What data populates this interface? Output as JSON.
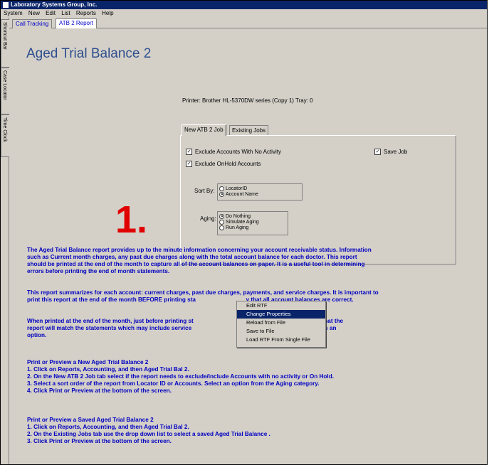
{
  "window": {
    "title": "Laboratory Systems Group, Inc."
  },
  "menubar": [
    "System",
    "New",
    "Edit",
    "List",
    "Reports",
    "Help"
  ],
  "left_tabs": [
    "Shortcut Bar",
    "Case Locator",
    "Time Clock"
  ],
  "tabs": [
    "Call Tracking",
    "ATB 2 Report"
  ],
  "page_title": "Aged Trial Balance 2",
  "printer_label": "Printer:   Brother HL-5370DW series (Copy 1) Tray: 0",
  "inner_tabs": [
    "New ATB 2 Job",
    "Existing Jobs"
  ],
  "options": {
    "exclude_no_activity": "Exclude Accounts With No Activity",
    "exclude_onhold": "Exclude OnHold Accounts",
    "save_job": "Save Job",
    "checked_mark": "✓"
  },
  "sort_by": {
    "label": "Sort By:",
    "options": [
      "LocatorID",
      "Account Name"
    ],
    "selected": "Account Name"
  },
  "aging": {
    "label": "Aging:",
    "options": [
      "Do Nothing",
      "Simulate Aging",
      "Run Aging"
    ],
    "selected": "Do Nothing"
  },
  "annotation": "1.",
  "description": {
    "p1": [
      "The Aged Trial Balance report provides up to the minute information concerning your account receivable status. Information",
      "such as Current month charges, any past due charges along with the total account balance for each doctor. This report",
      "should be printed at the end of the month to capture all of the account balances on paper. It is a useful tool in determining",
      "errors before printing the end of month statements."
    ],
    "p2": [
      "This report summarizes for each account: current charges, past due charges, payments, and service charges. It is important to",
      "print this report at the end of the month BEFORE printing sta                               y that all account balances are correct."
    ],
    "p3": [
      "When printed at the end of the month, just before printing st                                ose to “Simulate Aging” so that the",
      "report will match the statements which may include service                                 eport at any other time, this is an",
      "option."
    ],
    "new_heading": "Print or Preview a New Aged Trial Balance 2",
    "new_steps": [
      "1. Click on Reports, Accounting, and then Aged Trial Bal 2.",
      "2. On the New ATB 2 Job tab select if the report needs to exclude/include Accounts with no activity or On Hold.",
      "3. Select a sort order of the report from Locator ID or Accounts. Select an option from the Aging category.",
      "4. Click Print or Preview at the bottom of the screen."
    ],
    "saved_heading": "Print or Preview a Saved Aged Trial Balance 2",
    "saved_steps": [
      "1. Click on Reports, Accounting, and then Aged Trial Bal 2.",
      "2. On the Existing Jobs tab use the drop down list to select a saved Aged Trial Balance .",
      "3. Click Print or Preview at the bottom of the screen."
    ]
  },
  "context_menu": [
    "Edit RTF",
    "Change Properties",
    "Reload from File",
    "Save to File",
    "Load RTF From Single File"
  ],
  "colors": {
    "accent": "#0a246a",
    "text_blue": "#0000c0",
    "annotation_red": "#e00000"
  }
}
